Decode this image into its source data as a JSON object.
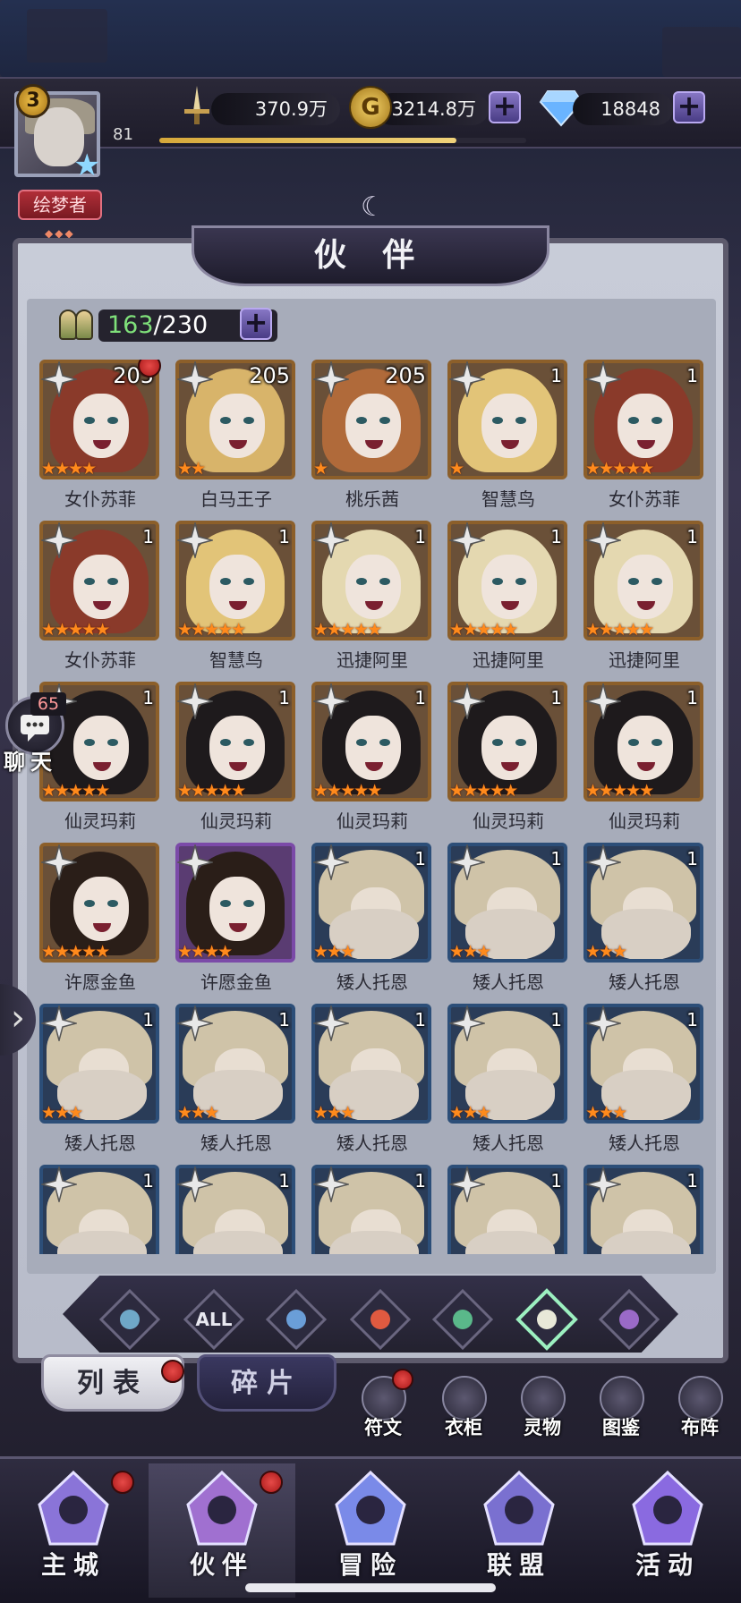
{
  "player": {
    "level": "3",
    "sub_level": "81",
    "title": "绘梦者",
    "xp_fraction": 0.81
  },
  "resources": {
    "power": "370.9万",
    "gold": "3214.8万",
    "diamonds": "18848"
  },
  "page": {
    "title": "伙 伴"
  },
  "capacity": {
    "current": "163",
    "max": "/230"
  },
  "chat": {
    "count": "65",
    "label": "聊天"
  },
  "heroes": [
    {
      "name": "女仆苏菲",
      "level": "205",
      "stars": 4,
      "frame": "gold",
      "hair": "#8a3a2a",
      "type": "girl",
      "badge": true
    },
    {
      "name": "白马王子",
      "level": "205",
      "stars": 2,
      "frame": "gold",
      "hair": "#d8b46a",
      "type": "prince"
    },
    {
      "name": "桃乐茜",
      "level": "205",
      "stars": 1,
      "frame": "gold",
      "hair": "#b06a3a",
      "type": "girl"
    },
    {
      "name": "智慧鸟",
      "level": "1",
      "stars": 1,
      "frame": "gold",
      "hair": "#e2c478",
      "type": "bird"
    },
    {
      "name": "女仆苏菲",
      "level": "1",
      "stars": 5,
      "frame": "gold",
      "hair": "#8a3a2a",
      "type": "girl"
    },
    {
      "name": "女仆苏菲",
      "level": "1",
      "stars": 5,
      "frame": "gold",
      "hair": "#8a3a2a",
      "type": "girl"
    },
    {
      "name": "智慧鸟",
      "level": "1",
      "stars": 5,
      "frame": "gold",
      "hair": "#e2c478",
      "type": "bird"
    },
    {
      "name": "迅捷阿里",
      "level": "1",
      "stars": 5,
      "frame": "gold",
      "hair": "#e4d8b0",
      "type": "ali"
    },
    {
      "name": "迅捷阿里",
      "level": "1",
      "stars": 5,
      "frame": "gold",
      "hair": "#e4d8b0",
      "type": "ali"
    },
    {
      "name": "迅捷阿里",
      "level": "1",
      "stars": 5,
      "frame": "gold",
      "hair": "#e4d8b0",
      "type": "ali"
    },
    {
      "name": "仙灵玛莉",
      "level": "1",
      "stars": 5,
      "frame": "gold",
      "hair": "#1e1a1c",
      "type": "elf"
    },
    {
      "name": "仙灵玛莉",
      "level": "1",
      "stars": 5,
      "frame": "gold",
      "hair": "#1e1a1c",
      "type": "elf"
    },
    {
      "name": "仙灵玛莉",
      "level": "1",
      "stars": 5,
      "frame": "gold",
      "hair": "#1e1a1c",
      "type": "elf"
    },
    {
      "name": "仙灵玛莉",
      "level": "1",
      "stars": 5,
      "frame": "gold",
      "hair": "#1e1a1c",
      "type": "elf"
    },
    {
      "name": "仙灵玛莉",
      "level": "1",
      "stars": 5,
      "frame": "gold",
      "hair": "#1e1a1c",
      "type": "elf"
    },
    {
      "name": "许愿金鱼",
      "level": "",
      "stars": 5,
      "frame": "gold",
      "hair": "#2a1e18",
      "type": "fish"
    },
    {
      "name": "许愿金鱼",
      "level": "",
      "stars": 4,
      "frame": "purple",
      "hair": "#2a1e18",
      "type": "fish"
    },
    {
      "name": "矮人托恩",
      "level": "1",
      "stars": 3,
      "frame": "blue",
      "hair": "#cfc3a8",
      "type": "dwarf"
    },
    {
      "name": "矮人托恩",
      "level": "1",
      "stars": 3,
      "frame": "blue",
      "hair": "#cfc3a8",
      "type": "dwarf"
    },
    {
      "name": "矮人托恩",
      "level": "1",
      "stars": 3,
      "frame": "blue",
      "hair": "#cfc3a8",
      "type": "dwarf"
    },
    {
      "name": "矮人托恩",
      "level": "1",
      "stars": 3,
      "frame": "blue",
      "hair": "#cfc3a8",
      "type": "dwarf"
    },
    {
      "name": "矮人托恩",
      "level": "1",
      "stars": 3,
      "frame": "blue",
      "hair": "#cfc3a8",
      "type": "dwarf"
    },
    {
      "name": "矮人托恩",
      "level": "1",
      "stars": 3,
      "frame": "blue",
      "hair": "#cfc3a8",
      "type": "dwarf"
    },
    {
      "name": "矮人托恩",
      "level": "1",
      "stars": 3,
      "frame": "blue",
      "hair": "#cfc3a8",
      "type": "dwarf"
    },
    {
      "name": "矮人托恩",
      "level": "1",
      "stars": 3,
      "frame": "blue",
      "hair": "#cfc3a8",
      "type": "dwarf"
    },
    {
      "name": "",
      "level": "1",
      "stars": 0,
      "frame": "blue",
      "hair": "#cfc3a8",
      "type": "dwarf"
    },
    {
      "name": "",
      "level": "1",
      "stars": 0,
      "frame": "blue",
      "hair": "#cfc3a8",
      "type": "dwarf"
    },
    {
      "name": "",
      "level": "1",
      "stars": 0,
      "frame": "blue",
      "hair": "#cfc3a8",
      "type": "dwarf"
    },
    {
      "name": "",
      "level": "1",
      "stars": 0,
      "frame": "blue",
      "hair": "#cfc3a8",
      "type": "dwarf"
    },
    {
      "name": "",
      "level": "1",
      "stars": 0,
      "frame": "blue",
      "hair": "#cfc3a8",
      "type": "dwarf"
    }
  ],
  "filters": [
    {
      "icon": "spear-element-icon",
      "label": "",
      "color": "#6fa8c8"
    },
    {
      "icon": "all-filter-icon",
      "label": "ALL",
      "color": "#e8e8f0"
    },
    {
      "icon": "water-element-icon",
      "label": "",
      "color": "#6a9ed8"
    },
    {
      "icon": "fire-element-icon",
      "label": "",
      "color": "#e05a40"
    },
    {
      "icon": "wind-element-icon",
      "label": "",
      "color": "#5ab88a"
    },
    {
      "icon": "light-element-icon",
      "label": "",
      "color": "#e8e8d8",
      "active": true
    },
    {
      "icon": "dark-element-icon",
      "label": "",
      "color": "#9a6ac8"
    }
  ],
  "tabs": {
    "list": "列表",
    "fragments": "碎片"
  },
  "side_buttons": [
    {
      "label": "符文",
      "icon": "rune-icon",
      "badge": true
    },
    {
      "label": "衣柜",
      "icon": "wardrobe-icon"
    },
    {
      "label": "灵物",
      "icon": "lamp-icon"
    },
    {
      "label": "图鉴",
      "icon": "codex-icon"
    },
    {
      "label": "布阵",
      "icon": "formation-icon"
    }
  ],
  "nav": [
    {
      "label": "主城",
      "icon": "castle-icon",
      "badge": true
    },
    {
      "label": "伙伴",
      "icon": "witch-hat-icon",
      "badge": true,
      "active": true
    },
    {
      "label": "冒险",
      "icon": "compass-portal-icon"
    },
    {
      "label": "联盟",
      "icon": "shield-crest-icon"
    },
    {
      "label": "活动",
      "icon": "cards-icon"
    }
  ]
}
